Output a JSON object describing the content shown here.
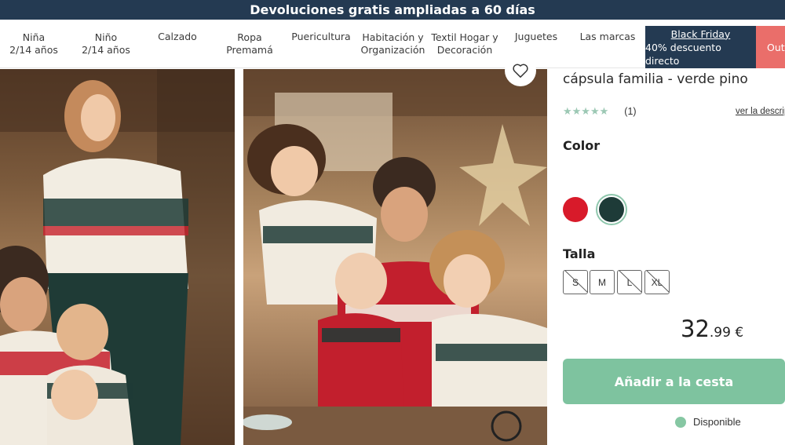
{
  "promo": {
    "text": "Devoluciones gratis ampliadas a 60 días"
  },
  "nav": {
    "items": [
      {
        "label": "Niña\n2/14 años"
      },
      {
        "label": "Niño\n2/14 años"
      },
      {
        "label": "Calzado"
      },
      {
        "label": "Ropa\nPremamá"
      },
      {
        "label": "Puericultura"
      },
      {
        "label": "Habitación y\nOrganización"
      },
      {
        "label": "Textil Hogar y\nDecoración"
      },
      {
        "label": "Juguetes"
      },
      {
        "label": "Las marcas"
      }
    ],
    "black_friday": {
      "title": "Black Friday",
      "subtitle": "40% descuento directo"
    },
    "outlet": {
      "label": "Outlet"
    }
  },
  "product": {
    "title": "cápsula familia - verde pino",
    "rating": {
      "stars": "★★★★★",
      "count": "(1)"
    },
    "description_link": "ver la descripción",
    "color_label": "Color",
    "colors": [
      {
        "name": "rojo",
        "hex": "#d81a2a"
      },
      {
        "name": "verde pino",
        "hex": "#1e3b38",
        "selected": true
      }
    ],
    "size_label": "Talla",
    "sizes": [
      {
        "label": "S",
        "available": false
      },
      {
        "label": "M",
        "available": true
      },
      {
        "label": "L",
        "available": false
      },
      {
        "label": "XL",
        "available": false
      }
    ],
    "price": {
      "integer": "32",
      "decimal": ".99 €"
    },
    "add_to_cart": "Añadir a la cesta",
    "availability": "Disponible"
  },
  "colors": {
    "promo_bg": "#243a52",
    "accent_green": "#7ec39f",
    "outlet_bg": "#ea6e6a"
  },
  "icons": {
    "favorite": "heart-icon"
  }
}
